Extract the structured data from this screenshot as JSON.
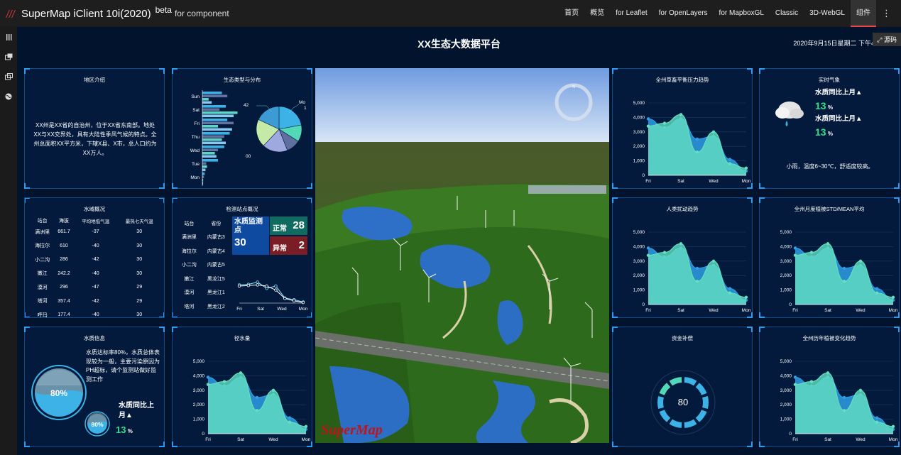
{
  "header": {
    "brand": "SuperMap iClient 10i(2020)",
    "beta": "beta",
    "subtitle": "for component",
    "nav": [
      "首页",
      "概览",
      "for Leaflet",
      "for OpenLayers",
      "for MapboxGL",
      "Classic",
      "3D-WebGL",
      "组件"
    ],
    "active_nav": "组件",
    "more": "⋮"
  },
  "sidebar": {
    "icons": [
      "menu-icon",
      "window-icon",
      "windows-icon",
      "globe-icon"
    ]
  },
  "dashboard": {
    "title": "XX生态大数据平台",
    "datetime": "2020年9月15日星期二 下午4:55:52",
    "source_label": "源码"
  },
  "panels": {
    "region": {
      "title": "地区介绍",
      "text": "XX州是XX省的自治州，位于XX省东南部。地处XX与XX交界处，具有大陆性季风气候的特点。全州总面积XX平方米，下辖X县、X市，总人口约为XX万人。"
    },
    "ecotype": {
      "title": "生态类型与分布",
      "pie_labels": [
        "42",
        "Mo",
        "00",
        "1"
      ]
    },
    "pressure": {
      "title": "全州草畜平衡压力趋势"
    },
    "weather": {
      "title": "实时气象",
      "line1": "水质同比上月▲",
      "value1": "13",
      "line2": "水质同比上月▲",
      "value2": "13",
      "unit": "%",
      "summary": "小雨，温度6~30℃，舒适度较高。"
    },
    "water_overview": {
      "title": "水域概况",
      "headers": [
        "站台",
        "海拔",
        "平均地低气温",
        "最热七天气温"
      ],
      "rows": [
        [
          "满洲里",
          "661.7",
          "-37",
          "30"
        ],
        [
          "海拉尔",
          "610",
          "-40",
          "30"
        ],
        [
          "小二沟",
          "286",
          "-42",
          "30"
        ],
        [
          "嫩江",
          "242.2",
          "-40",
          "30"
        ],
        [
          "漠河",
          "296",
          "-47",
          "29"
        ],
        [
          "塔河",
          "357.4",
          "-42",
          "29"
        ],
        [
          "呼玛",
          "177.4",
          "-40",
          "30"
        ]
      ]
    },
    "stations": {
      "title": "检测站点概况",
      "headers": [
        "站台",
        "省份"
      ],
      "rows": [
        [
          "满洲里",
          "内蒙古3"
        ],
        [
          "海拉尔",
          "内蒙古4"
        ],
        [
          "小二沟",
          "内蒙古5"
        ],
        [
          "嫩江",
          "黑龙江5"
        ],
        [
          "漠河",
          "黑龙江1"
        ],
        [
          "塔河",
          "黑龙江2"
        ]
      ],
      "monitor_label": "水质监测点",
      "monitor_value": "30",
      "normal_label": "正常",
      "normal_value": "28",
      "abnormal_label": "异常",
      "abnormal_value": "2"
    },
    "human": {
      "title": "人类扰动趋势"
    },
    "ndvi": {
      "title": "全州月度植被STD/MEAN平均"
    },
    "water_info": {
      "title": "水质信息",
      "text": "水质达标率80%，水质总体表现较为一般，主要污染原因为PH超标，请个监测站做好监测工作",
      "gauge_big": "80%",
      "gauge_small": "80%",
      "change_label": "水质同比上月▲",
      "change_value": "13",
      "unit": "%"
    },
    "rainfall": {
      "title": "径水量"
    },
    "funding": {
      "title": "资金补偿",
      "value": "80"
    },
    "veg_history": {
      "title": "全州历年植被变化趋势"
    }
  },
  "map": {
    "watermark": "SuperMap"
  },
  "chart_data": [
    {
      "id": "area-trend",
      "type": "area",
      "x": [
        "Sun",
        "Mon",
        "Tue",
        "Wed",
        "Thu",
        "Fri",
        "Sat"
      ],
      "x_tick_labels": [
        "Fri",
        "Sat",
        "Wed",
        "Mon"
      ],
      "series": [
        {
          "values": [
            3900,
            3300,
            3900,
            2500,
            2700,
            1100,
            300
          ]
        },
        {
          "values": [
            3400,
            3600,
            4200,
            1600,
            3000,
            800,
            500
          ]
        }
      ],
      "ylim": [
        0,
        5000
      ],
      "yticks": [
        "0",
        "1,000",
        "2,000",
        "3,000",
        "4,000",
        "5,000"
      ],
      "colors": [
        "#2f9ee6",
        "#62e0c0"
      ],
      "used_in": [
        "pressure",
        "human",
        "ndvi",
        "rainfall",
        "veg_history"
      ]
    },
    {
      "id": "ecotype-bars",
      "type": "bar",
      "orientation": "horizontal",
      "categories": [
        "Sun",
        "Sat",
        "Fri",
        "Thu",
        "Wed",
        "Tue",
        "Mon"
      ],
      "series": [
        {
          "values": [
            25,
            30,
            32,
            35,
            28,
            20,
            3
          ]
        },
        {
          "values": [
            32,
            22,
            40,
            28,
            20,
            5,
            2
          ]
        },
        {
          "values": [
            8,
            45,
            20,
            25,
            16,
            6,
            1
          ]
        },
        {
          "values": [
            12,
            40,
            38,
            30,
            18,
            4,
            1
          ]
        }
      ],
      "colors": [
        "#3db2e6",
        "#6272a0",
        "#5bd5c6",
        "#8bc8f0"
      ]
    },
    {
      "id": "ecotype-pie",
      "type": "pie",
      "values": [
        22,
        12,
        10,
        18,
        20,
        18
      ],
      "colors": [
        "#3db2e6",
        "#52d8b6",
        "#5e6fa0",
        "#a0a8e0",
        "#c5eaa8",
        "#3c9bd4"
      ]
    },
    {
      "id": "station-line",
      "type": "line",
      "x": [
        "Fri",
        "Sat",
        "Wed",
        "Mon"
      ],
      "x_tick_labels": [
        "Fri",
        "Sat",
        "Wed",
        "Mon"
      ],
      "series": [
        {
          "values": [
            3.2,
            3.3,
            3.7,
            2.6,
            3.0,
            0.9,
            0.6,
            0.2
          ]
        },
        {
          "values": [
            3.0,
            3.1,
            3.2,
            3.0,
            2.3,
            0.8,
            0.4,
            0.1
          ]
        }
      ],
      "colors": [
        "#8fe3ff",
        "#ffffff"
      ]
    },
    {
      "id": "funding-ring",
      "type": "pie",
      "values": [
        80,
        20
      ],
      "colors": [
        "#3db2e6",
        "#1b3a5c"
      ]
    }
  ]
}
